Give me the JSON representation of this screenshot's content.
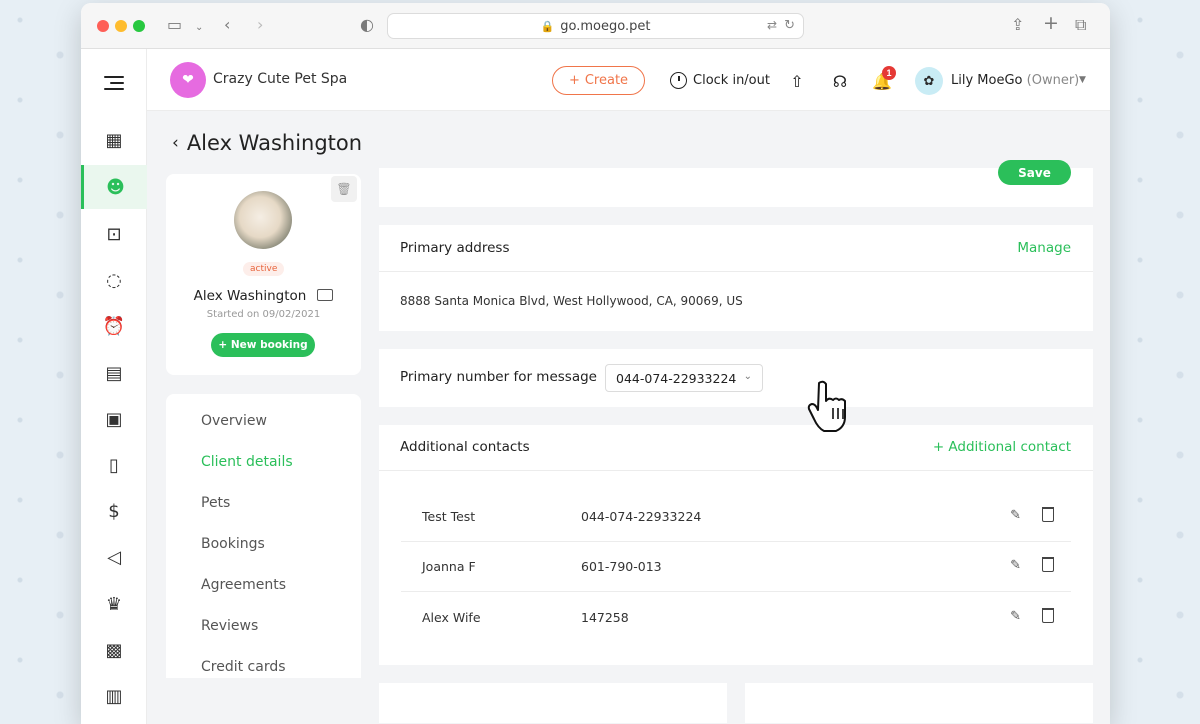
{
  "browser": {
    "url": "go.moego.pet"
  },
  "appbar": {
    "business_name": "Crazy Cute Pet Spa",
    "create_label": "Create",
    "clock_label": "Clock in/out",
    "notification_count": "1",
    "user_name": "Lily MoeGo",
    "user_role": "(Owner)"
  },
  "page": {
    "title": "Alex Washington"
  },
  "profile": {
    "status": "active",
    "name": "Alex Washington",
    "started": "Started on 09/02/2021",
    "new_booking_label": "+ New booking"
  },
  "side_menu": {
    "items": [
      {
        "label": "Overview"
      },
      {
        "label": "Client details"
      },
      {
        "label": "Pets"
      },
      {
        "label": "Bookings"
      },
      {
        "label": "Agreements"
      },
      {
        "label": "Reviews"
      },
      {
        "label": "Credit cards"
      }
    ],
    "active": "Client details"
  },
  "main": {
    "save_label": "Save",
    "primary_address": {
      "title": "Primary address",
      "action": "Manage",
      "address": "8888 Santa Monica Blvd, West Hollywood, CA, 90069, US"
    },
    "primary_number": {
      "label": "Primary number for message",
      "value": "044-074-22933224"
    },
    "additional_contacts": {
      "title": "Additional contacts",
      "action": "+ Additional contact",
      "rows": [
        {
          "name": "Test Test",
          "phone": "044-074-22933224"
        },
        {
          "name": "Joanna F",
          "phone": "601-790-013"
        },
        {
          "name": "Alex Wife",
          "phone": "147258"
        }
      ]
    }
  },
  "chat": {
    "badge": "1"
  },
  "colors": {
    "brand_green": "#2bbf5a",
    "accent_orange": "#f0754a"
  }
}
